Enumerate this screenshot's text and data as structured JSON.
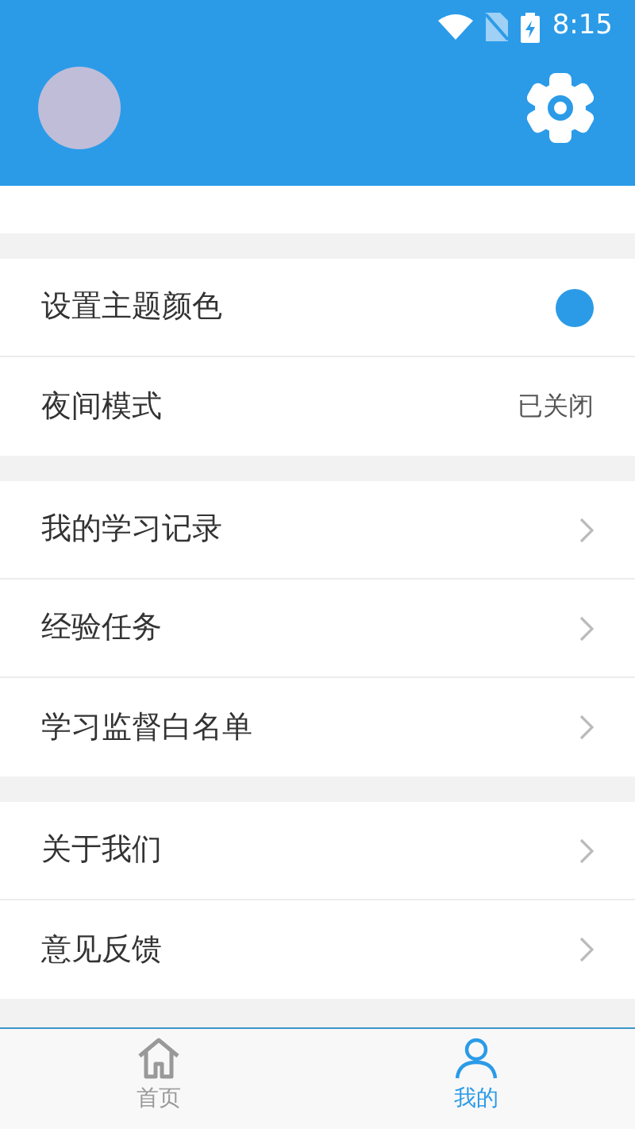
{
  "status_bar": {
    "time": "8:15"
  },
  "groups": [
    [
      {
        "kind": "color",
        "label": "设置主题颜色",
        "color": "#2b9be8"
      },
      {
        "kind": "value",
        "label": "夜间模式",
        "value": "已关闭"
      }
    ],
    [
      {
        "kind": "link",
        "label": "我的学习记录"
      },
      {
        "kind": "link",
        "label": "经验任务"
      },
      {
        "kind": "link",
        "label": "学习监督白名单"
      }
    ],
    [
      {
        "kind": "link",
        "label": "关于我们"
      },
      {
        "kind": "link",
        "label": "意见反馈"
      }
    ]
  ],
  "tabs": [
    {
      "label": "首页",
      "kind": "home",
      "selected": false
    },
    {
      "label": "我的",
      "kind": "person",
      "selected": true
    }
  ]
}
